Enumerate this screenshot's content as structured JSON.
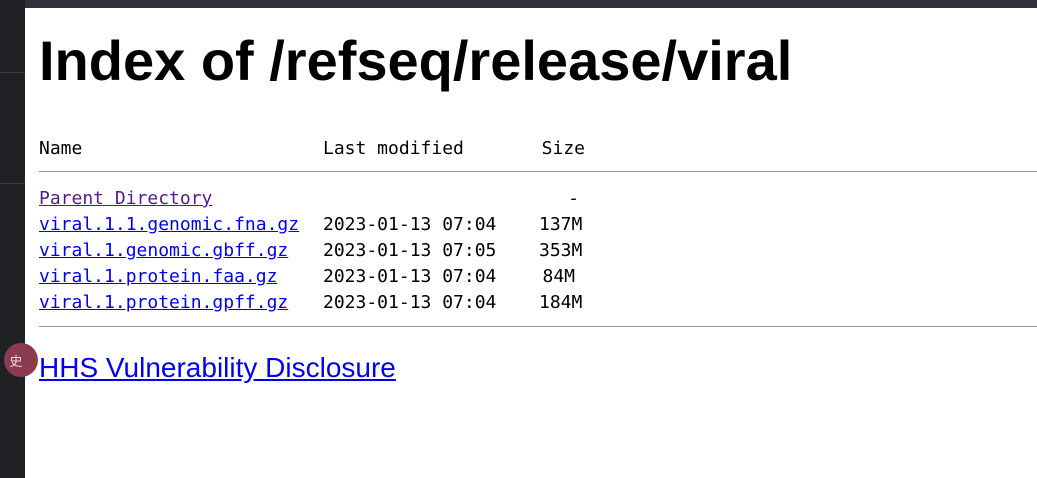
{
  "page": {
    "title": "Index of /refseq/release/viral"
  },
  "sidebar": {
    "avatar_text": "史"
  },
  "listing": {
    "headers": {
      "name": "Name",
      "modified": "Last modified",
      "size": "Size"
    },
    "parent": {
      "name": "Parent Directory",
      "size": "-"
    },
    "rows": [
      {
        "name": "viral.1.1.genomic.fna.gz",
        "modified": "2023-01-13 07:04",
        "size": "137M"
      },
      {
        "name": "viral.1.genomic.gbff.gz",
        "modified": "2023-01-13 07:05",
        "size": "353M"
      },
      {
        "name": "viral.1.protein.faa.gz",
        "modified": "2023-01-13 07:04",
        "size": "84M"
      },
      {
        "name": "viral.1.protein.gpff.gz",
        "modified": "2023-01-13 07:04",
        "size": "184M"
      }
    ]
  },
  "footer": {
    "link_text": "HHS Vulnerability Disclosure"
  },
  "colors": {
    "link": "#0000ee",
    "visited": "#551a8b",
    "sidebar": "#1f2124"
  }
}
